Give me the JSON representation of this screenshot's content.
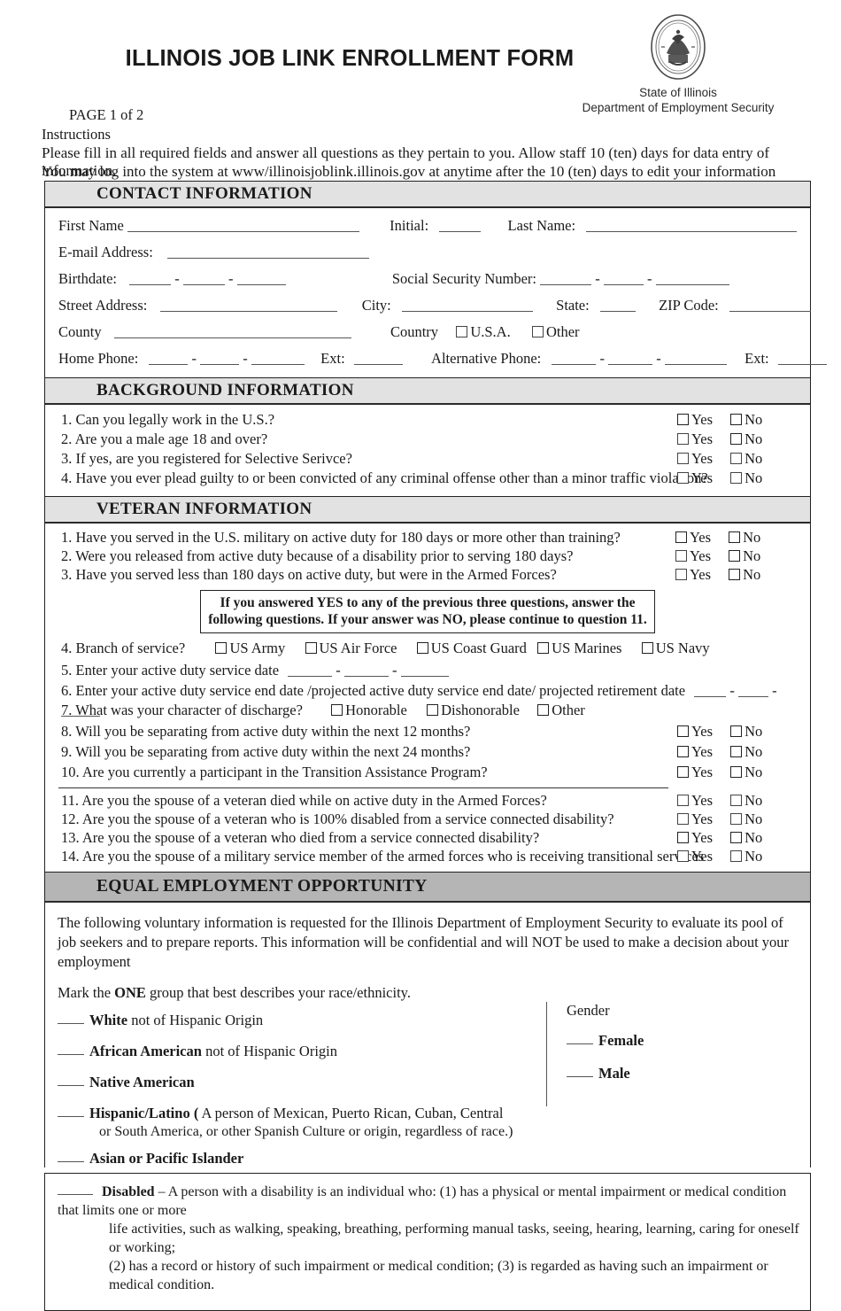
{
  "header": {
    "title": "ILLINOIS JOB LINK ENROLLMENT FORM",
    "seal_icon": "state-of-illinois-seal",
    "agency_line1": "State of Illinois",
    "agency_line2": "Department of Employment Security",
    "page_label": "PAGE 1 of 2",
    "instructions_title": "Instructions",
    "instructions_line1": "Please fill in all required fields and answer all questions as they pertain to you. Allow staff 10 (ten) days for data entry of information.",
    "instructions_line2": "You may log into the system at www/illinoisjoblink.illinois.gov at anytime after the 10 (ten) days to edit your information"
  },
  "colors": {
    "section_header_light": "#e2e2e2",
    "section_header_dark": "#b5b5b5",
    "border": "#222222",
    "rule": "#555555"
  },
  "contact": {
    "heading": "CONTACT INFORMATION",
    "first_name_label": "First Name",
    "initial_label": "Initial:",
    "last_name_label": "Last Name:",
    "email_label": "E-mail Address:",
    "birthdate_label": "Birthdate:",
    "ssn_label": "Social Security Number:",
    "street_label": "Street Address:",
    "city_label": "City:",
    "state_label": "State:",
    "zip_label": "ZIP Code:",
    "county_label": "County",
    "country_label": "Country",
    "country_usa": "U.S.A.",
    "country_other": "Other",
    "home_phone_label": "Home Phone:",
    "ext_label": "Ext:",
    "alt_phone_label": "Alternative Phone:",
    "ext2_label": "Ext:",
    "dash": "-"
  },
  "background": {
    "heading": "BACKGROUND  INFORMATION",
    "yes": "Yes",
    "no": "No",
    "questions": [
      "1. Can you legally work in the U.S.?",
      "2. Are you a male age 18 and over?",
      "3. If yes, are you registered for Selective Serivce?",
      "4. Have you ever plead guilty to or been convicted of any criminal offense other than a minor traffic violation?"
    ]
  },
  "veteran": {
    "heading": "VETERAN INFORMATION",
    "yes": "Yes",
    "no": "No",
    "questions_top": [
      "1. Have you served in the U.S. military on active duty for 180 days or more other than training?",
      "2. Were you released from active duty because of a disability prior to serving 180 days?",
      "3. Have you served less than 180 days on active duty, but were in the Armed Forces?"
    ],
    "notice_line1": "If you answered YES to any of the previous three questions, answer the following",
    "notice_line2": "questions. If your answer was NO, please continue to question 11.",
    "q4_label": "4. Branch of service?",
    "branches": [
      "US Army",
      "US Air Force",
      "US Coast Guard",
      "US Marines",
      "US Navy"
    ],
    "q5_label": "5. Enter your active duty service date",
    "q6_label": "6. Enter your active duty service end date /projected active duty service end date/ projected retirement date",
    "q7_label": "7. What was your character of discharge?",
    "discharge": [
      "Honorable",
      "Dishonorable",
      "Other"
    ],
    "questions_mid": [
      "8. Will you be separating from active duty within the next 12 months?",
      "9. Will you be separating from active duty within the next 24 months?",
      "10. Are you currently a participant in the Transition Assistance Program?"
    ],
    "questions_bottom": [
      "11. Are you the spouse of a veteran died while on active duty in the Armed Forces?",
      "12. Are you the spouse of a veteran who is 100% disabled from a service connected disability?",
      "13. Are you the spouse of a veteran who died from a service connected disability?",
      "14. Are you the spouse of a military service member of the armed forces who is receiving transitional services"
    ],
    "dash": "-"
  },
  "eeo": {
    "heading": "EQUAL EMPLOYMENT OPPORTUNITY",
    "para_line1": "The following voluntary information is requested for the Illinois Department of Employment Security to evaluate its pool of job",
    "para_line2": "seekers and to prepare reports. This information will be confidential and will NOT be used to make a decision about your employment",
    "mark_pre": "Mark the ",
    "mark_one": "ONE",
    "mark_post": " group that best describes your race/ethnicity.",
    "race_options": [
      {
        "bold": "White",
        "rest": " not of Hispanic Origin",
        "sub": ""
      },
      {
        "bold": "African American",
        "rest": " not of Hispanic Origin",
        "sub": ""
      },
      {
        "bold": "Native American",
        "rest": "",
        "sub": ""
      },
      {
        "bold": "Hispanic/Latino (",
        "rest": "  A person of Mexican, Puerto Rican, Cuban, Central",
        "sub": "or South America, or other Spanish Culture or origin, regardless of race.)"
      },
      {
        "bold": "Asian or Pacific Islander",
        "rest": "",
        "sub": ""
      }
    ],
    "gender_title": "Gender",
    "gender_options": [
      "Female",
      "Male"
    ]
  },
  "disabled": {
    "bold": "Disabled",
    "line1": " – A person with a disability is an individual who: (1) has a physical or mental impairment or medical condition that limits one or more",
    "line2": "life activities, such as walking, speaking, breathing, performing manual tasks, seeing, hearing, learning, caring for oneself or working;",
    "line3": "(2) has a record or history of such impairment or medical condition; (3) is regarded as having such an impairment or medical condition."
  }
}
